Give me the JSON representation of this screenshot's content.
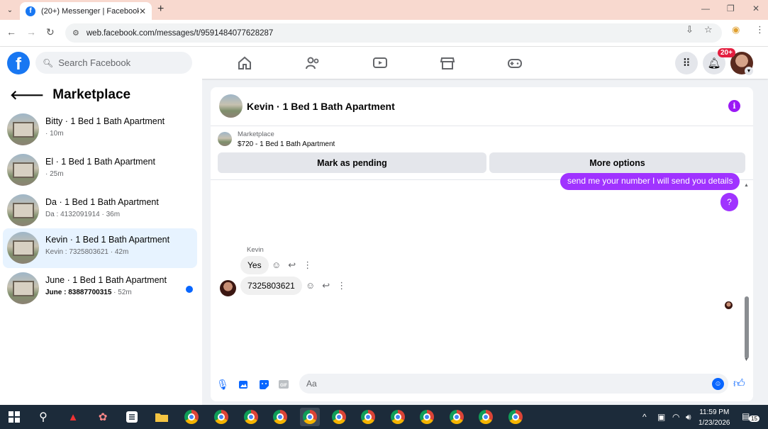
{
  "browser": {
    "tab_title": "(20+) Messenger | Facebook",
    "url": "web.facebook.com/messages/t/9591484077628287"
  },
  "header": {
    "search_placeholder": "Search Facebook",
    "notif_badge": "20+"
  },
  "sidebar": {
    "title": "Marketplace",
    "conversations": [
      {
        "title": "Bitty · 1 Bed 1 Bath Apartment",
        "subtitle": "· 10m",
        "active": false,
        "unread": false
      },
      {
        "title": "El · 1 Bed 1 Bath Apartment",
        "subtitle": "· 25m",
        "active": false,
        "unread": false
      },
      {
        "title": "Da · 1 Bed 1 Bath Apartment",
        "subtitle": "Da : 4132091914 · 36m",
        "active": false,
        "unread": false
      },
      {
        "title": "Kevin · 1 Bed 1 Bath Apartment",
        "subtitle": "Kevin : 7325803621 · 42m",
        "active": true,
        "unread": false
      },
      {
        "title": "June · 1 Bed 1 Bath Apartment",
        "subtitle": "June : 83887700315",
        "time": " · 52m",
        "active": false,
        "unread": true
      }
    ]
  },
  "chat": {
    "title": "Kevin · 1 Bed 1 Bath Apartment",
    "marketplace_label": "Marketplace",
    "listing": "$720 - 1 Bed 1 Bath Apartment",
    "mark_pending": "Mark as pending",
    "more_options": "More options",
    "outgoing_1": "send me your number I will send you details",
    "outgoing_2": "?",
    "sender_name": "Kevin",
    "incoming_1": "Yes",
    "incoming_2": "7325803621",
    "composer_placeholder": "Aa"
  },
  "taskbar": {
    "time": "11:59 PM",
    "date": "1/23/2026",
    "notif_count": "15"
  },
  "colors": {
    "accent": "#0866ff",
    "outgoing_bubble": "#a033ff",
    "active_conv": "#e7f3ff"
  }
}
